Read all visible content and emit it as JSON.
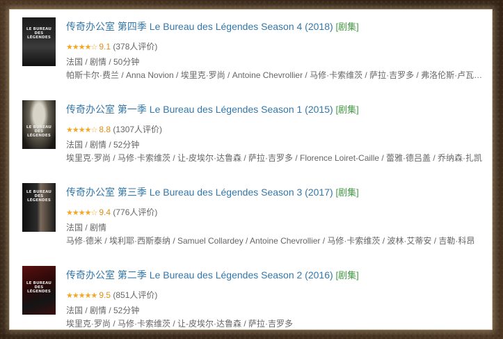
{
  "items": [
    {
      "poster_text": "LE BUREAU DES LÉGENDES",
      "title": "传奇办公室 第四季 Le Bureau des Légendes Season 4 (2018)",
      "episode_link": "[剧集]",
      "stars": "★★★★☆",
      "score": "9.1",
      "votes": "(378人评价)",
      "meta": "法国 / 剧情 / 50分钟",
      "cast": "帕斯卡尔·费兰 / Anna Novion / 埃里克·罗尚 / Antoine Chevrollier / 马修·卡索维茨 / 萨拉·吉罗多 / 弗洛伦斯·卢瓦雷-卡耶"
    },
    {
      "poster_text": "LE BUREAU DES LÉGENDES",
      "title": "传奇办公室 第一季 Le Bureau des Légendes Season 1 (2015)",
      "episode_link": "[剧集]",
      "stars": "★★★★☆",
      "score": "8.8",
      "votes": "(1307人评价)",
      "meta": "法国 / 剧情 / 52分钟",
      "cast": "埃里克·罗尚 / 马修·卡索维茨 / 让-皮埃尔·达鲁森 / 萨拉·吉罗多 / Florence Loiret-Caille / 蕾雅·德吕盖 / 乔纳森·扎凯"
    },
    {
      "poster_text": "LE BUREAU DES LÉGENDES",
      "title": "传奇办公室 第三季 Le Bureau des Légendes Season 3 (2017)",
      "episode_link": "[剧集]",
      "stars": "★★★★☆",
      "score": "9.4",
      "votes": "(776人评价)",
      "meta": "法国 / 剧情",
      "cast": "马修·德米 / 埃利耶·西斯泰纳 / Samuel Collardey / Antoine Chevrollier / 马修·卡索维茨 / 波林·艾蒂安 / 吉勒·科昂"
    },
    {
      "poster_text": "LE BUREAU DES LÉGENDES",
      "title": "传奇办公室 第二季 Le Bureau des Légendes Season 2 (2016)",
      "episode_link": "[剧集]",
      "stars": "★★★★★",
      "score": "9.5",
      "votes": "(851人评价)",
      "meta": "法国 / 剧情 / 52分钟",
      "cast": "埃里克·罗尚 / 马修·卡索维茨 / 让-皮埃尔·达鲁森 / 萨拉·吉罗多"
    }
  ],
  "colors": {
    "title_link": "#3377aa",
    "episode_link": "#449944",
    "star": "#f5a623",
    "score": "#e09015",
    "meta_text": "#666666"
  }
}
